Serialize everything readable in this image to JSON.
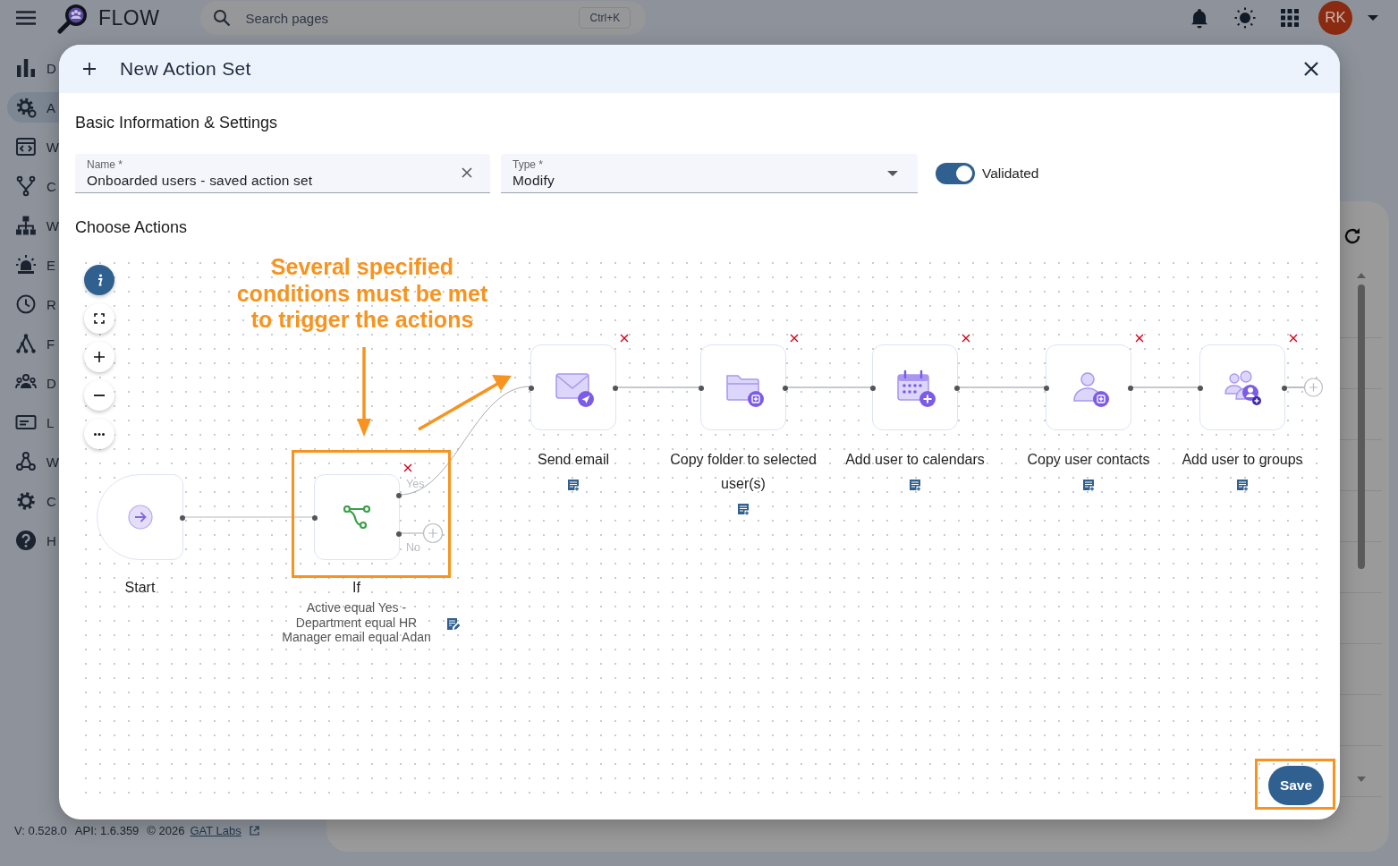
{
  "top_bar": {
    "app_name": "FLOW",
    "search": {
      "placeholder": "Search pages",
      "shortcut": "Ctrl+K"
    },
    "avatar_initials": "RK"
  },
  "sidebar": {
    "items": [
      {
        "label": "D",
        "selected": false
      },
      {
        "label": "A",
        "selected": true
      },
      {
        "label": "W",
        "selected": false
      },
      {
        "label": "C",
        "selected": false
      },
      {
        "label": "W",
        "selected": false
      },
      {
        "label": "E",
        "selected": false
      },
      {
        "label": "R",
        "selected": false
      },
      {
        "label": "F",
        "selected": false
      },
      {
        "label": "D",
        "selected": false
      },
      {
        "label": "L",
        "selected": false
      },
      {
        "label": "W",
        "selected": false
      },
      {
        "label": "C",
        "selected": false
      },
      {
        "label": "H",
        "selected": false
      }
    ]
  },
  "dialog": {
    "title": "New Action Set",
    "section_title": "Basic Information & Settings",
    "name_field": {
      "label": "Name *",
      "value": "Onboarded users - saved action set"
    },
    "type_field": {
      "label": "Type *",
      "value": "Modify"
    },
    "validated": {
      "label": "Validated",
      "on": true
    },
    "actions_title": "Choose Actions",
    "flow": {
      "start": {
        "label": "Start"
      },
      "condition": {
        "label": "If",
        "yes_label": "Yes",
        "no_label": "No",
        "description": [
          "Active equal Yes -",
          "Department equal HR",
          "Manager email equal Adan"
        ]
      },
      "actions": [
        {
          "label": "Send email"
        },
        {
          "label": "Copy folder to selected user(s)"
        },
        {
          "label": "Add user to calendars"
        },
        {
          "label": "Copy user contacts"
        },
        {
          "label": "Add user to groups"
        }
      ]
    },
    "annotation": {
      "lines": [
        "Several specified",
        "conditions must be met",
        "to trigger the actions"
      ]
    },
    "save_button": "Save"
  },
  "footer": {
    "version": "V: 0.528.0",
    "api": "API: 1.6.359",
    "copyright": "© 2026",
    "link": "GAT Labs"
  }
}
